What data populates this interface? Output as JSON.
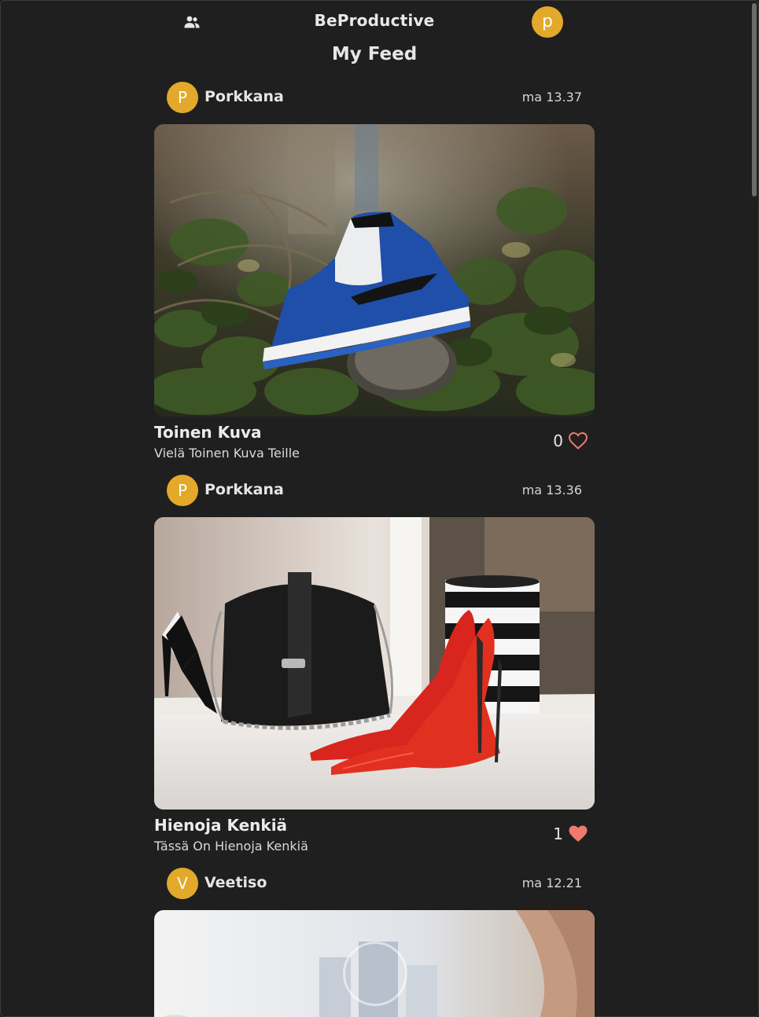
{
  "header": {
    "title": "BeProductive",
    "user_initial": "p",
    "friends_icon": "people-icon"
  },
  "feed_title": "My Feed",
  "posts": [
    {
      "author": "Porkkana",
      "author_initial": "P",
      "time": "ma 13.37",
      "title": "Toinen Kuva",
      "description": "Vielä Toinen Kuva Teille",
      "likes": "0",
      "liked": false,
      "image": "blue sneaker on ivy"
    },
    {
      "author": "Porkkana",
      "author_initial": "P",
      "time": "ma 13.36",
      "title": "Hienoja Kenkiä",
      "description": "Tässä On Hienoja Kenkiä",
      "likes": "1",
      "liked": true,
      "image": "red heels with black handbag"
    },
    {
      "author": "Veetiso",
      "author_initial": "V",
      "time": "ma 12.21",
      "image": "loading image"
    }
  ],
  "colors": {
    "background": "#1f1f1f",
    "avatar": "#e3a92a",
    "heart": "#f07a6e"
  }
}
